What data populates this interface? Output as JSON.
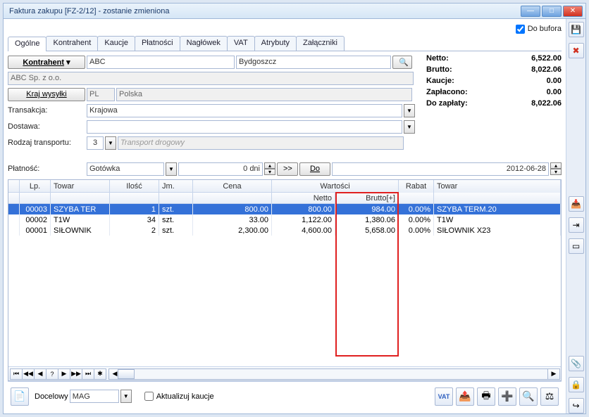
{
  "title": "Faktura zakupu [FZ-2/12]  - zostanie zmieniona",
  "do_bufora_label": "Do bufora",
  "tabs": [
    "Ogólne",
    "Kontrahent",
    "Kaucje",
    "Płatności",
    "Nagłówek",
    "VAT",
    "Atrybuty",
    "Załączniki"
  ],
  "kontrahent_btn": "Kontrahent",
  "kontrahent_code": "ABC",
  "kontrahent_city": "Bydgoszcz",
  "kontrahent_name": "ABC Sp. z o.o.",
  "kraj_btn": "Kraj wysyłki",
  "kraj_code": "PL",
  "kraj_name": "Polska",
  "transakcja_lbl": "Transakcja:",
  "transakcja_val": "Krajowa",
  "dostawa_lbl": "Dostawa:",
  "dostawa_val": "",
  "rodzaj_lbl": "Rodzaj transportu:",
  "rodzaj_val": "3",
  "rodzaj_desc": "Transport drogowy",
  "totals": {
    "netto_k": "Netto:",
    "netto_v": "6,522.00",
    "brutto_k": "Brutto:",
    "brutto_v": "8,022.06",
    "kaucje_k": "Kaucje:",
    "kaucje_v": "0.00",
    "zapl_k": "Zapłacono:",
    "zapl_v": "0.00",
    "doz_k": "Do zapłaty:",
    "doz_v": "8,022.06"
  },
  "platnosc_lbl": "Płatność:",
  "platnosc_val": "Gotówka",
  "platnosc_dni": "0 dni",
  "dbl_arrow": ">>",
  "do_btn": "Do",
  "date": "2012-06-28",
  "grid": {
    "headers": {
      "lp": "Lp.",
      "towar": "Towar",
      "ilosc": "Ilość",
      "jm": "Jm.",
      "cena": "Cena",
      "wartosci": "Wartości",
      "netto": "Netto",
      "brutto": "Brutto[+]",
      "rabat": "Rabat",
      "towar2": "Towar"
    },
    "rows": [
      {
        "lp": "00003",
        "towar": "SZYBA TER",
        "ilosc": "1",
        "jm": "szt.",
        "cena": "800.00",
        "netto": "800.00",
        "brutto": "984.00",
        "rabat": "0.00%",
        "towar2": "SZYBA TERM.20"
      },
      {
        "lp": "00002",
        "towar": "T1W",
        "ilosc": "34",
        "jm": "szt.",
        "cena": "33.00",
        "netto": "1,122.00",
        "brutto": "1,380.06",
        "rabat": "0.00%",
        "towar2": "T1W"
      },
      {
        "lp": "00001",
        "towar": "SIŁOWNIK",
        "ilosc": "2",
        "jm": "szt.",
        "cena": "2,300.00",
        "netto": "4,600.00",
        "brutto": "5,658.00",
        "rabat": "0.00%",
        "towar2": "SIŁOWNIK X23"
      }
    ]
  },
  "docelowy_lbl": "Docelowy",
  "mag_val": "MAG",
  "aktualizuj_lbl": "Aktualizuj kaucje",
  "icons": {
    "save": "💾",
    "cancel": "✖",
    "down": "▾",
    "up": "▴",
    "search": "🔍",
    "first": "⏮",
    "prev": "◀",
    "next": "▶",
    "last": "⏭",
    "qmark": "?",
    "star": "✱",
    "minus": "−",
    "arrow": "↳",
    "vat": "VAT",
    "export": "📤",
    "print": "🖶",
    "plus": "➕",
    "scale": "⚖",
    "clip": "📎",
    "exit": "↪"
  }
}
